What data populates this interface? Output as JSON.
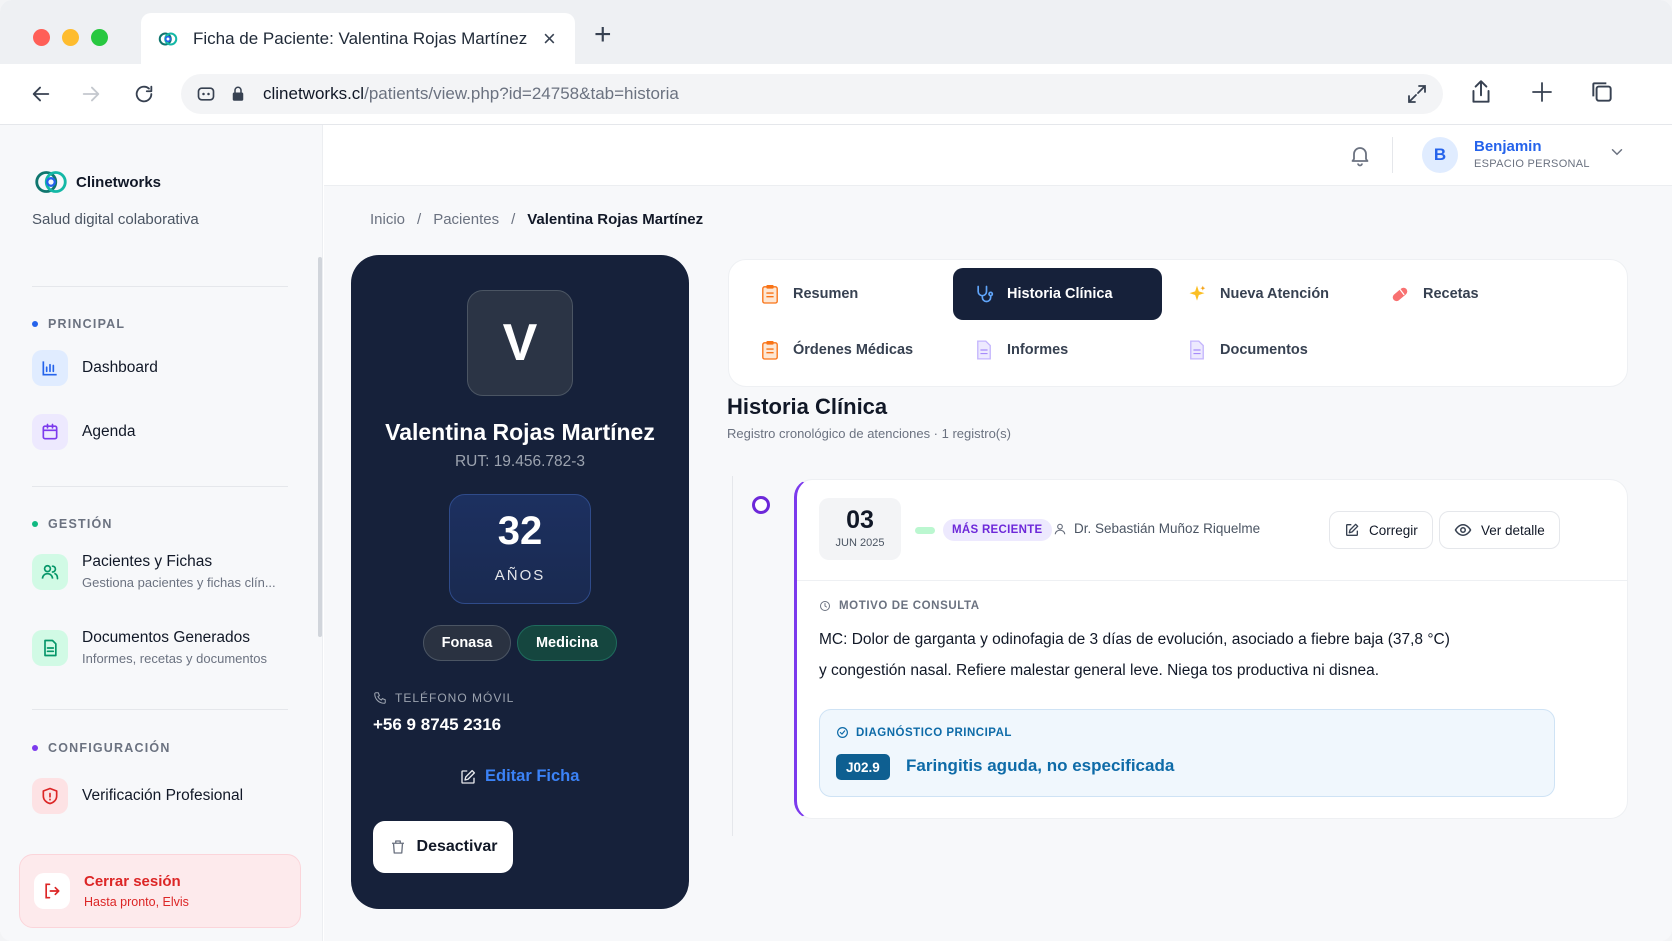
{
  "browser": {
    "tab_title": "Ficha de Paciente: Valentina Rojas Martínez",
    "url_domain": "clinetworks.cl",
    "url_path": "/patients/view.php?id=24758&tab=historia"
  },
  "sidebar": {
    "brand": "Clinetworks",
    "tagline": "Salud digital colaborativa",
    "sections": {
      "principal": "PRINCIPAL",
      "gestion": "GESTIÓN",
      "configuracion": "CONFIGURACIÓN"
    },
    "items": {
      "dashboard": "Dashboard",
      "agenda": "Agenda",
      "pacientes": "Pacientes y Fichas",
      "pacientes_sub": "Gestiona pacientes y fichas clín...",
      "documentos": "Documentos Generados",
      "documentos_sub": "Informes, recetas y documentos",
      "verificacion": "Verificación Profesional"
    },
    "logout": {
      "title": "Cerrar sesión",
      "sub": "Hasta pronto, Elvis"
    }
  },
  "header": {
    "avatar_letter": "B",
    "user_name": "Benjamin",
    "user_space": "ESPACIO PERSONAL"
  },
  "breadcrumb": {
    "home": "Inicio",
    "sep": "/",
    "patients": "Pacientes",
    "current": "Valentina Rojas Martínez"
  },
  "patient": {
    "initial": "V",
    "name": "Valentina Rojas Martínez",
    "rut": "RUT: 19.456.782-3",
    "age": "32",
    "age_label": "AÑOS",
    "insurance": "Fonasa",
    "specialty": "Medicina",
    "phone_label": "TELÉFONO MÓVIL",
    "phone": "+56 9 8745 2316",
    "edit": "Editar Ficha",
    "deactivate": "Desactivar"
  },
  "tabs": {
    "resumen": "Resumen",
    "historia": "Historia Clínica",
    "nueva": "Nueva Atención",
    "recetas": "Recetas",
    "ordenes": "Órdenes Médicas",
    "informes": "Informes",
    "documentos": "Documentos"
  },
  "historia": {
    "title": "Historia Clínica",
    "subtitle": "Registro cronológico de atenciones · 1 registro(s)",
    "entry": {
      "day": "03",
      "month": "JUN 2025",
      "badge": "MÁS RECIENTE",
      "doctor": "Dr. Sebastián Muñoz Riquelme",
      "correct": "Corregir",
      "detail": "Ver detalle",
      "motivo_label": "MOTIVO DE CONSULTA",
      "motivo_line1": "MC: Dolor de garganta y odinofagia de 3 días de evolución, asociado a fiebre baja (37,8 °C)",
      "motivo_line2": "y congestión nasal. Refiere malestar general leve. Niega tos productiva ni disnea.",
      "diag_label": "DIAGNÓSTICO PRINCIPAL",
      "diag_code": "J02.9",
      "diag_name": "Faringitis aguda, no especificada"
    }
  },
  "colors": {
    "navy": "#16213a",
    "accent_blue": "#2563eb",
    "violet": "#7c3aed",
    "danger": "#dc2626",
    "diag_blue": "#0e6ba8"
  }
}
